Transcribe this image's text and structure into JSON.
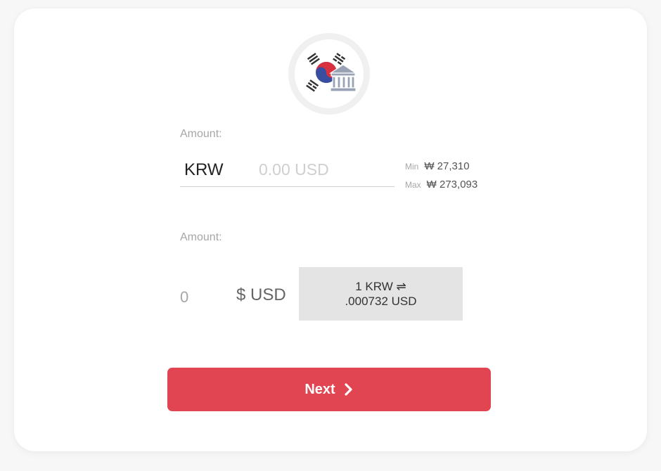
{
  "logo": {
    "icon": "korea-flag-bank-icon"
  },
  "from": {
    "label": "Amount:",
    "currency": "KRW",
    "placeholder": "0.00 USD",
    "min_label": "Min",
    "min_value": "₩ 27,310",
    "max_label": "Max",
    "max_value": "₩ 273,093"
  },
  "to": {
    "label": "Amount:",
    "value": "0",
    "currency": "$ USD"
  },
  "rate": {
    "line1": "1 KRW ⇌",
    "line2": ".000732 USD"
  },
  "actions": {
    "next_label": "Next",
    "next_icon": "chevron-right-icon",
    "next_color": "#e04551"
  }
}
